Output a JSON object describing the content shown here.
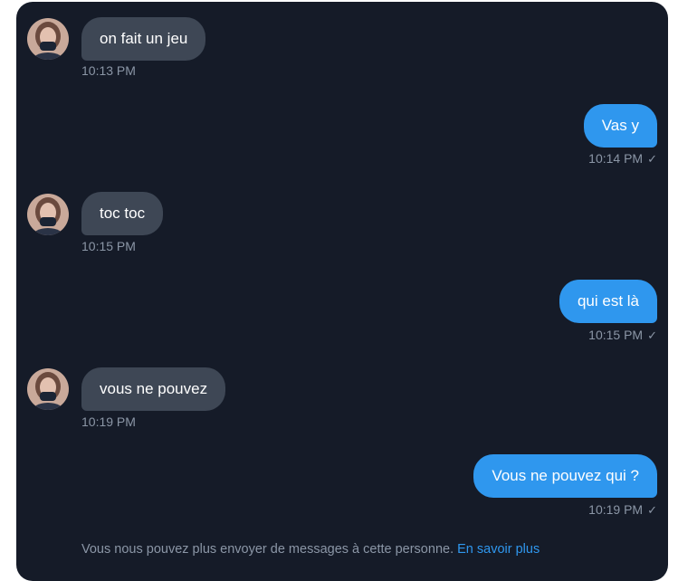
{
  "conversation": {
    "messages": [
      {
        "direction": "in",
        "text": "on fait un jeu",
        "time": "10:13 PM"
      },
      {
        "direction": "out",
        "text": "Vas y",
        "time": "10:14 PM",
        "status_icon": "check-icon"
      },
      {
        "direction": "in",
        "text": "toc toc",
        "time": "10:15 PM"
      },
      {
        "direction": "out",
        "text": "qui est là",
        "time": "10:15 PM",
        "status_icon": "check-icon"
      },
      {
        "direction": "in",
        "text": "vous ne pouvez",
        "time": "10:19 PM"
      },
      {
        "direction": "out",
        "text": "Vous ne pouvez qui ?",
        "time": "10:19 PM",
        "status_icon": "check-icon"
      }
    ]
  },
  "footer": {
    "notice": "Vous nous pouvez plus envoyer de messages à cette personne.",
    "link_label": "En savoir plus"
  },
  "colors": {
    "background": "#151b28",
    "incoming_bubble": "#3e4755",
    "outgoing_bubble": "#2f97ee",
    "timestamp": "#8b96a6",
    "link": "#2f97ee"
  },
  "icons": {
    "avatar": "avatar-icon",
    "sent_status": "check-icon"
  }
}
